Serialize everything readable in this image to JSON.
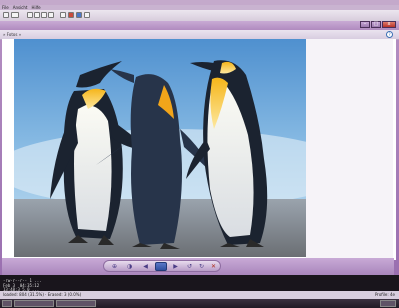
{
  "host": {
    "menu": [
      "File",
      "Ansicht",
      "Hilfe"
    ]
  },
  "viewer": {
    "title_controls": {
      "minimize": "–",
      "maximize": "□",
      "close": "x"
    },
    "nav_text": "» Fotos »",
    "help_label": "?",
    "photo_alt": "Penguins",
    "controls": {
      "zoom_label": "⊕",
      "fit_label": "◑",
      "prev_label": "◀",
      "next_label": "▶",
      "rotate_left_label": "↺",
      "rotate_right_label": "↻",
      "delete_label": "✕"
    }
  },
  "terminal": {
    "lines": [
      "-rw-r--r-- 1 ...",
      "Feb 3  04:35:12",
      "13:48:3 5.0 ... "
    ]
  },
  "status": {
    "left": "loaded: 804 (31.5%) · Erased: 3 (0.0%)",
    "right": "Profile: 4e"
  },
  "colors": {
    "frame": "#b48fc2",
    "accent": "#2f4f9f"
  }
}
